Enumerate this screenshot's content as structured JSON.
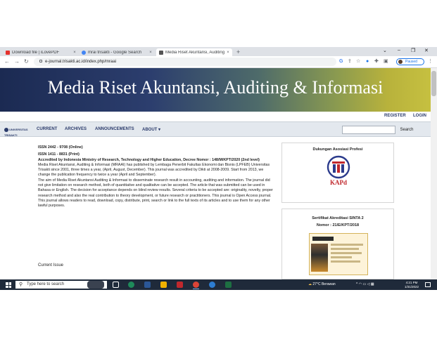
{
  "browser": {
    "tabs": [
      {
        "title": "Download file | iLovePDF",
        "active": false,
        "favicon_color": "#e5322d"
      },
      {
        "title": "mrai trisakti - Google Search",
        "active": false,
        "favicon_color": "#4285f4"
      },
      {
        "title": "Media Riset Akuntansi, Auditing",
        "active": true,
        "favicon_color": "#555555"
      }
    ],
    "close_glyph": "×",
    "new_tab_glyph": "+",
    "window_controls": [
      "⌄",
      "–",
      "❐",
      "✕"
    ],
    "url": "e-journal.trisakti.ac.id/index.php/mraai",
    "profile_label": "Paused"
  },
  "site": {
    "title": "Media Riset Akuntansi, Auditing & Informasi",
    "top_links": [
      "REGISTER",
      "LOGIN"
    ],
    "logo_text": "UNIVERSITAS TRISAKTI",
    "nav": [
      "CURRENT",
      "ARCHIVES",
      "ANNOUNCEMENTS",
      "ABOUT ▾"
    ],
    "search_button": "Search"
  },
  "main": {
    "issn_online": "ISSN 2442 - 9708 (Online)",
    "issn_print": "ISSN 1411 - 8831 (Print)",
    "accreditation": "Accredited by Indonesia Ministry of Research, Technology and Higher Education, Decree Nomor : 148/M/KPT/2020 (2nd level)",
    "paragraph1": "Media Riset Akuntansi, Auditing & Informasi (MRAAI) has published by Lembaga Penerbit Fakultas Ekonomi dan Bisnis (LPFEB) Universitas Trisakti since 2001, three times a year, (April, August, December). This journal was accredited by Dikti at 2008-2009. Start from 2013, we change the publication frequency to twice a year (April and September).",
    "paragraph2": "The aim of Media Riset Akuntansi Auditing & Informasi to disseminate research result in accounting, auditing and information. The journal did not give limitation on research method, both of quantitative and qualitative can be accepted. The article that was submitted can be used in Bahasa or English. The decision for acceptance depends on blind review results. Several criteria to be accepted are: originality, novelty, proper research method and also the real contribution to theory development, or future research or practitioners. This journal is Open Access journal. This journal allows readers to read, download, copy, distribute, print, search or link to the full texts of its articles and to use them for any other lawful purposes.",
    "current_issue_heading": "Current Issue"
  },
  "sidebar": {
    "block1_title": "Dukungan Asosiasi Profesi",
    "kapd_text": "KAPd",
    "block2_title": "Sertifikat Akreditasi SINTA 2",
    "block2_subtitle": "Nomor : 21/E/KPT/2018"
  },
  "taskbar": {
    "search_placeholder": "Type here to search",
    "weather": "27°C  Berawan",
    "clock_time": "4:21 PM",
    "clock_date": "1/31/2022"
  },
  "colors": {
    "banner_start": "#1b2a52",
    "banner_end": "#c6c040",
    "nav_text": "#2b3b6b",
    "kapd_red": "#c0282d",
    "kapd_blue": "#2b3b8c"
  }
}
